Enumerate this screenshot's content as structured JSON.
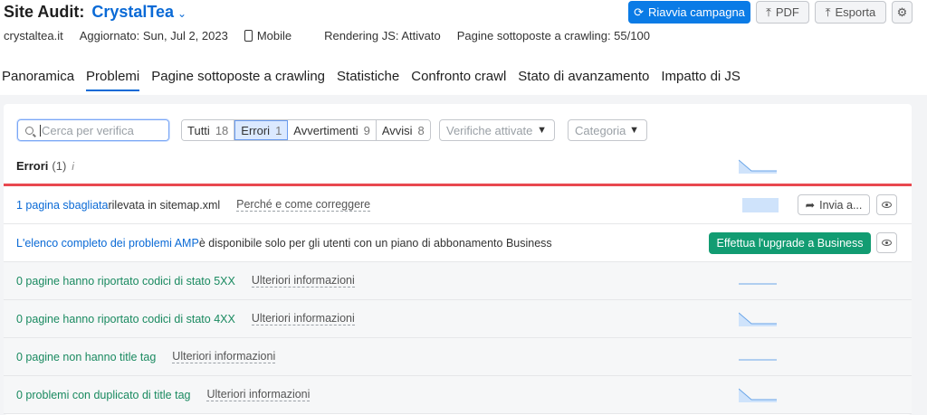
{
  "header": {
    "title": "Site Audit:",
    "project": "CrystalTea",
    "domain": "crystaltea.it",
    "updated": "Aggiornato: Sun, Jul 2, 2023",
    "device": "Mobile",
    "rendering": "Rendering JS: Attivato",
    "crawled": "Pagine sottoposte a crawling: 55/100",
    "restart_label": "Riavvia campagna",
    "pdf_label": "PDF",
    "export_label": "Esporta"
  },
  "tabs": [
    {
      "label": "Panoramica"
    },
    {
      "label": "Problemi"
    },
    {
      "label": "Pagine sottoposte a crawling"
    },
    {
      "label": "Statistiche"
    },
    {
      "label": "Confronto crawl"
    },
    {
      "label": "Stato di avanzamento"
    },
    {
      "label": "Impatto di JS"
    }
  ],
  "filters": {
    "search_placeholder": "Cerca per verifica",
    "segments": [
      {
        "label": "Tutti",
        "count": "18"
      },
      {
        "label": "Errori",
        "count": "1"
      },
      {
        "label": "Avvertimenti",
        "count": "9"
      },
      {
        "label": "Avvisi",
        "count": "8"
      }
    ],
    "checks_dropdown": "Verifiche attivate",
    "category_dropdown": "Categoria"
  },
  "section": {
    "title": "Errori",
    "count": "(1)",
    "info": "i"
  },
  "rows": [
    {
      "link": "1 pagina sbagliata",
      "text": " rilevata in sitemap.xml",
      "help": "Perché e come correggere",
      "send_label": "Invia a..."
    },
    {
      "link": "L'elenco completo dei problemi AMP",
      "text": " è disponibile solo per gli utenti con un piano di abbonamento Business",
      "upgrade_label": "Effettua l'upgrade a Business"
    },
    {
      "text": "0 pagine hanno riportato codici di stato 5XX",
      "help": "Ulteriori informazioni"
    },
    {
      "text": "0 pagine hanno riportato codici di stato 4XX",
      "help": "Ulteriori informazioni"
    },
    {
      "text": "0 pagine non hanno title tag",
      "help": "Ulteriori informazioni"
    },
    {
      "text": "0 problemi con duplicato di title tag",
      "help": "Ulteriori informazioni"
    }
  ],
  "colors": {
    "brand_blue": "#0a6ad6",
    "primary_button": "#0a7be6",
    "upgrade_green": "#129c72",
    "error_red": "#e8484f"
  }
}
